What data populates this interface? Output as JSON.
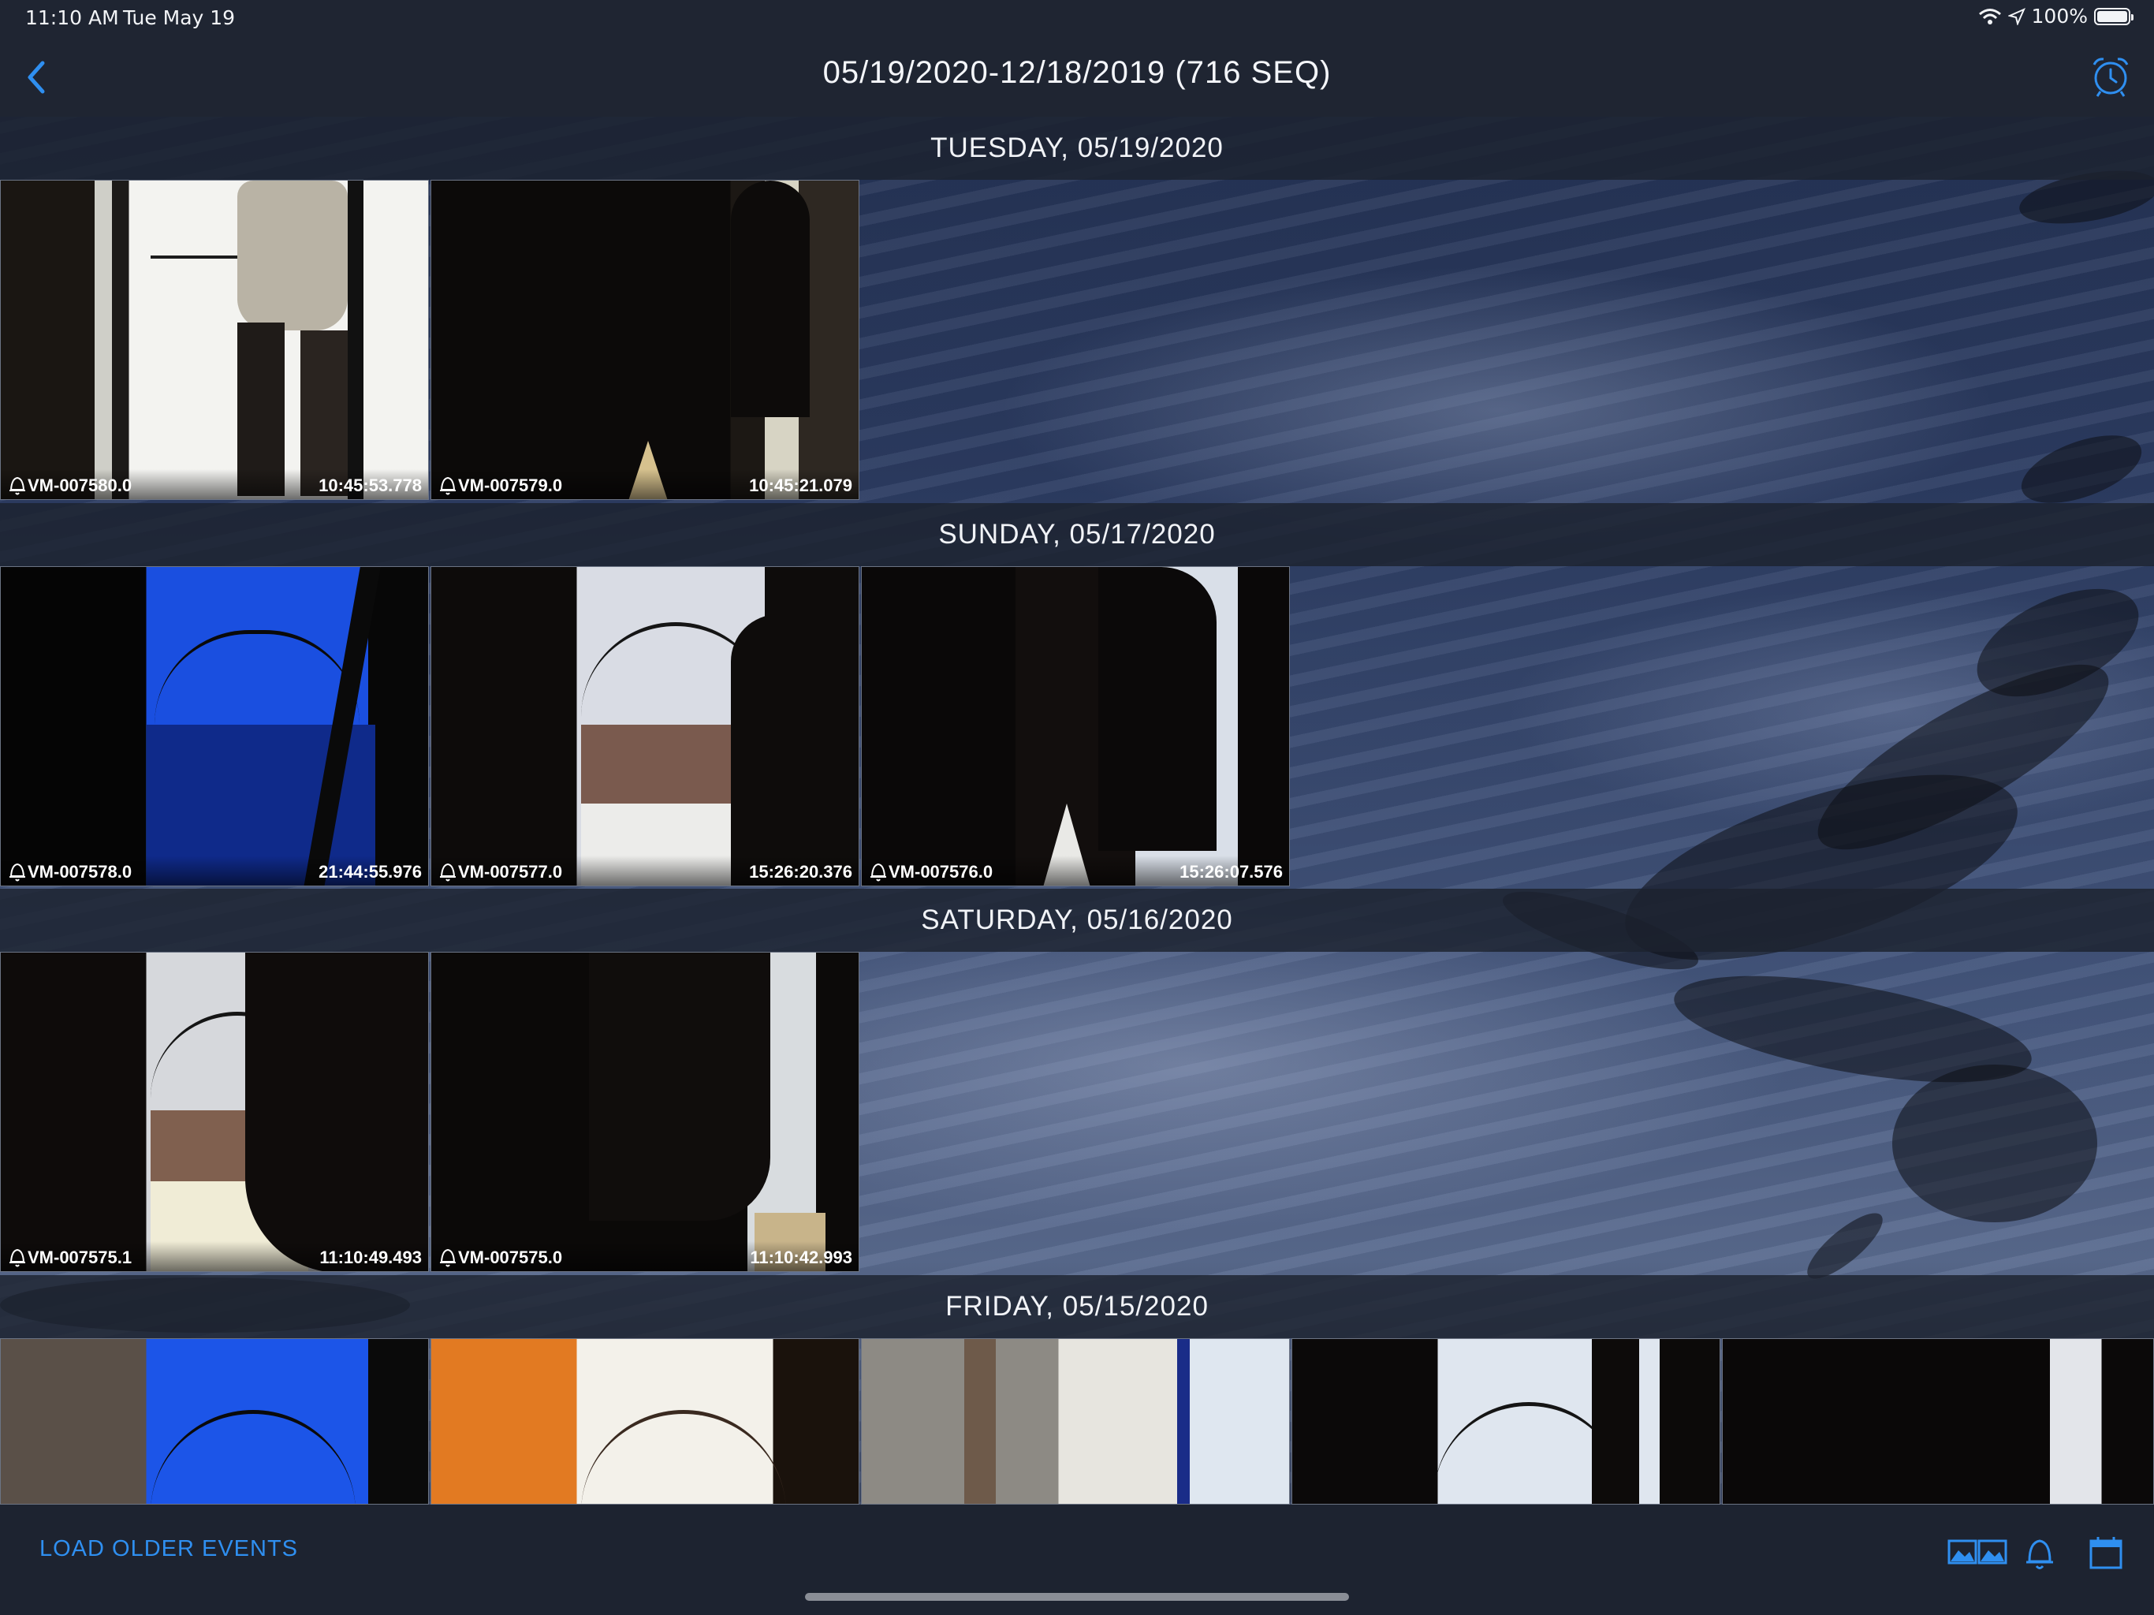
{
  "status_bar": {
    "time": "11:10 AM",
    "date": "Tue May 19",
    "battery": "100%",
    "icons": [
      "wifi-icon",
      "location-arrow-icon",
      "battery-icon"
    ]
  },
  "nav": {
    "title": "05/19/2020-12/18/2019 (716 SEQ)",
    "back_icon": "chevron-left-icon",
    "alarm_icon": "alarm-clock-icon"
  },
  "sections": [
    {
      "header": "TUESDAY, 05/19/2020",
      "events": [
        {
          "camera": "VM-007580.0",
          "time": "10:45:53.778"
        },
        {
          "camera": "VM-007579.0",
          "time": "10:45:21.079"
        }
      ]
    },
    {
      "header": "SUNDAY, 05/17/2020",
      "events": [
        {
          "camera": "VM-007578.0",
          "time": "21:44:55.976"
        },
        {
          "camera": "VM-007577.0",
          "time": "15:26:20.376"
        },
        {
          "camera": "VM-007576.0",
          "time": "15:26:07.576"
        }
      ]
    },
    {
      "header": "SATURDAY, 05/16/2020",
      "events": [
        {
          "camera": "VM-007575.1",
          "time": "11:10:49.493"
        },
        {
          "camera": "VM-007575.0",
          "time": "11:10:42.993"
        }
      ]
    },
    {
      "header": "FRIDAY, 05/15/2020",
      "events": [
        {},
        {},
        {},
        {},
        {}
      ]
    }
  ],
  "toolbar": {
    "load_older": "LOAD OLDER EVENTS",
    "icons": [
      "thumbnails-icon",
      "bell-icon",
      "calendar-icon"
    ],
    "accent_color": "#2f8ff0"
  }
}
